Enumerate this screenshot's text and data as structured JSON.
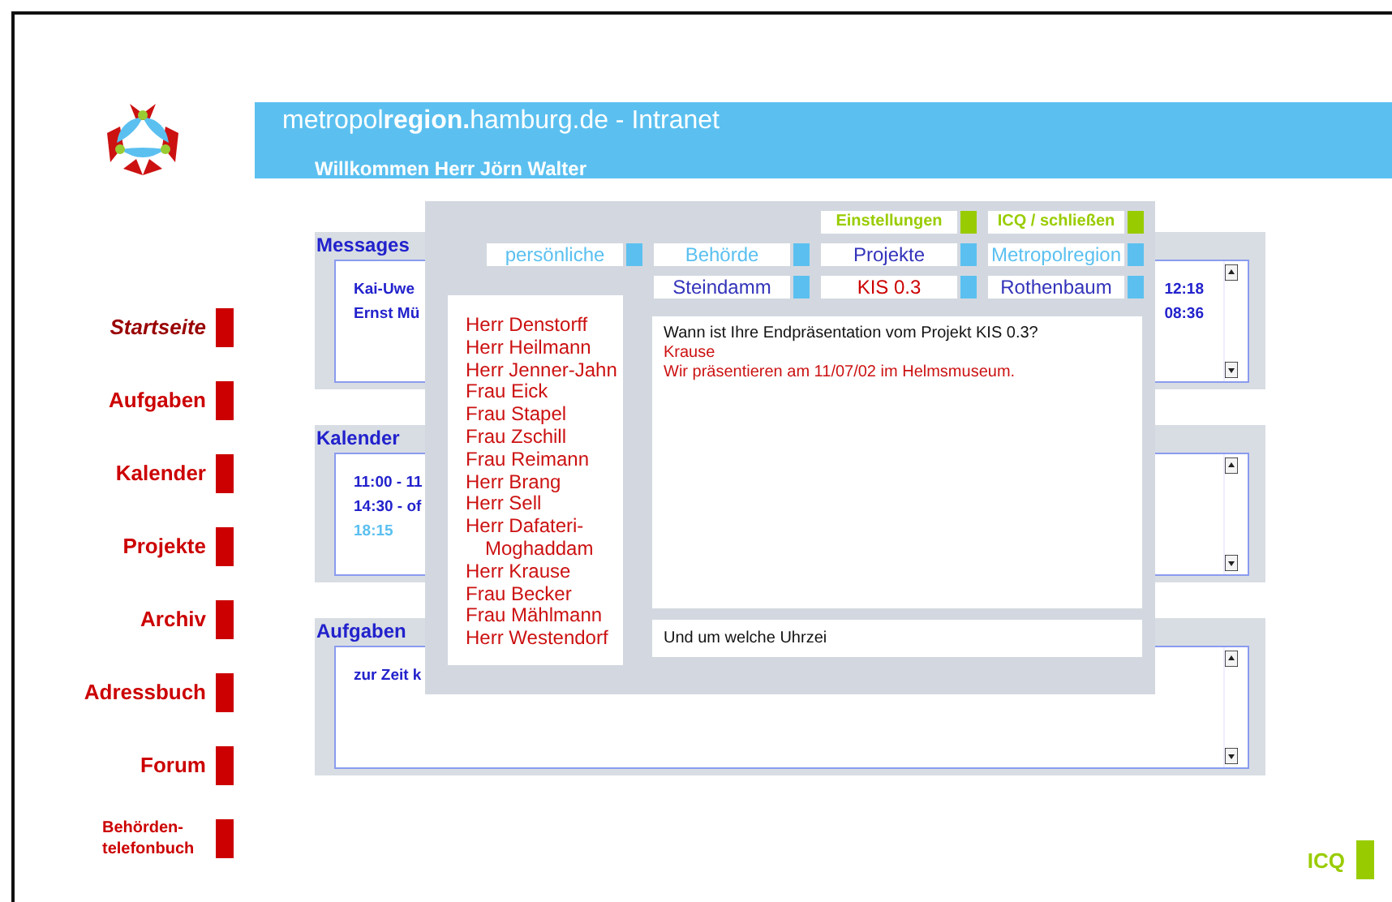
{
  "header": {
    "title": "metropol**region.**hamburg.de - Intranet",
    "welcome": "Willkommen Herr Jörn Walter"
  },
  "sidebar": {
    "items": [
      {
        "label": "Startseite",
        "selected": true,
        "kind": "normal"
      },
      {
        "label": "Aufgaben",
        "selected": false,
        "kind": "normal"
      },
      {
        "label": "Kalender",
        "selected": false,
        "kind": "normal"
      },
      {
        "label": "Projekte",
        "selected": false,
        "kind": "normal"
      },
      {
        "label": "Archiv",
        "selected": false,
        "kind": "normal"
      },
      {
        "label": "Adressbuch",
        "selected": false,
        "kind": "normal"
      },
      {
        "label": "Forum",
        "selected": false,
        "kind": "normal"
      },
      {
        "label": "Behörden-telefonbuch",
        "selected": false,
        "kind": "small"
      }
    ]
  },
  "panels": [
    {
      "title": "Messages",
      "rows": [
        {
          "text": "Kai-Uwe",
          "time": "12:18",
          "color": "#2222cc"
        },
        {
          "text": "Ernst Mü",
          "time": "08:36",
          "color": "#2222cc"
        }
      ]
    },
    {
      "title": "Kalender",
      "rows": [
        {
          "text": "11:00 - 11",
          "color": "#2222cc"
        },
        {
          "text": "14:30 - of",
          "color": "#2222cc"
        },
        {
          "text": "18:15",
          "color": "#5bc0f0"
        }
      ]
    },
    {
      "title": "Aufgaben",
      "rows": [
        {
          "text": "zur Zeit k",
          "color": "#2222cc"
        }
      ]
    }
  ],
  "icq_dialog": {
    "tab_rows": [
      [
        {
          "label": "Einstellungen",
          "color": "#99cc00",
          "kind": "action"
        },
        {
          "label": "ICQ / schließen",
          "color": "#99cc00",
          "kind": "action"
        }
      ],
      [
        {
          "label": "persönliche",
          "color": "#5bc0f0",
          "kind": "group"
        },
        {
          "label": "Behörde",
          "color": "#5bc0f0",
          "kind": "group"
        },
        {
          "label": "Projekte",
          "color": "#3333bb",
          "kind": "group"
        },
        {
          "label": "Metropolregion",
          "color": "#5bc0f0",
          "kind": "group"
        }
      ],
      [
        {
          "label": "Steindamm",
          "color": "#3333bb",
          "kind": "group"
        },
        {
          "label": "KIS 0.3",
          "color": "#cc0000",
          "kind": "group"
        },
        {
          "label": "Rothenbaum",
          "color": "#3333bb",
          "kind": "group"
        }
      ]
    ],
    "contacts": [
      "Herr Denstorff",
      "Herr Heilmann",
      "Herr Jenner-Jahn",
      "Frau Eick",
      "Frau Stapel",
      "Frau Zschill",
      "Frau Reimann",
      "Herr Brang",
      "Herr Sell",
      "Herr Dafateri-Moghaddam",
      "Herr Krause",
      "Frau Becker",
      "Frau Mählmann",
      "Herr Westendorf"
    ],
    "messages": [
      {
        "text": "Wann ist Ihre Endpräsentation vom Projekt KIS 0.3?",
        "kind": "question"
      },
      {
        "text": "Krause",
        "kind": "reply"
      },
      {
        "text": "Wir präsentieren am 11/07/02 im Helmsmuseum.",
        "kind": "reply"
      }
    ],
    "input": {
      "value": "Und um welche Uhrzei"
    }
  },
  "footer": {
    "icq": "ICQ"
  }
}
